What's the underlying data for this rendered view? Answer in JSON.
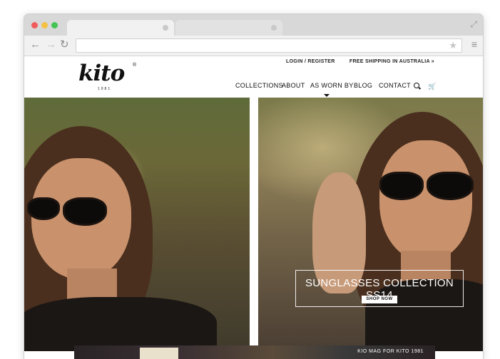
{
  "header": {
    "top_links": [
      "LOGIN / REGISTER",
      "FREE SHIPPING IN AUSTRALIA »"
    ],
    "logo_text": "kito",
    "logo_year": "1981",
    "logo_reg": "®"
  },
  "nav": {
    "items": [
      "COLLECTIONS",
      "ABOUT",
      "AS WORN BY",
      "BLOG",
      "CONTACT"
    ],
    "icons": [
      "search-icon",
      "cart-icon"
    ]
  },
  "hero": {
    "banner_title": "SUNGLASSES COLLECTION SS14",
    "banner_button": "SHOP NOW"
  },
  "bottom": {
    "strip_text": "KIO MAG FOR KITO 1981"
  },
  "colors": {
    "accent": "#111111",
    "chrome": "#d8d8d8"
  }
}
